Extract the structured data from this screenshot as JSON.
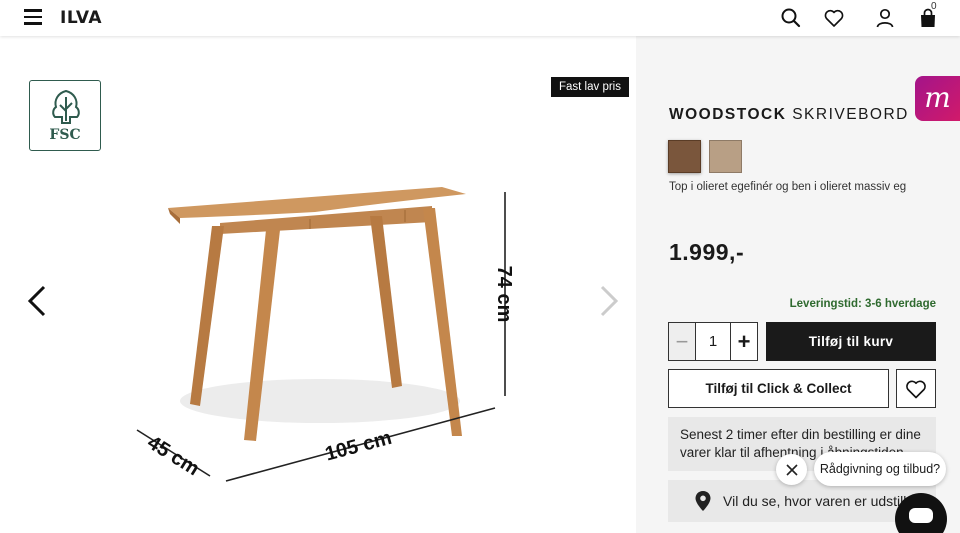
{
  "header": {
    "logo": "ILVA",
    "cart_count": "0",
    "icons": [
      "menu-icon",
      "search-icon",
      "heart-icon",
      "user-icon",
      "bag-icon"
    ]
  },
  "gallery": {
    "fsc_label": "FSC",
    "badge": "Fast lav pris",
    "dimensions": {
      "height": "74 cm",
      "width": "105 cm",
      "depth": "45 cm"
    }
  },
  "product": {
    "brand": "WOODSTOCK",
    "type": "SKRIVEBORD",
    "description": "Top i olieret egefinér og ben i olieret massiv eg",
    "price": "1.999,-",
    "delivery": "Leveringstid: 3-6 hverdage",
    "quantity": "1",
    "swatches": [
      "#7a563c",
      "#b89f85"
    ]
  },
  "actions": {
    "add_to_cart": "Tilføj til kurv",
    "click_collect": "Tilføj til Click & Collect",
    "pickup_info": "Senest 2 timer efter din bestilling er dine varer klar til afhentning i åbningstiden.",
    "store_prompt": "Vil du se, hvor varen er udstillet?"
  },
  "chat": {
    "bubble": "Rådgivning og tilbud?"
  },
  "colors": {
    "accent_dark": "#1a1a1a",
    "delivery_green": "#2f6a2f",
    "m_badge": "#b8157f"
  }
}
